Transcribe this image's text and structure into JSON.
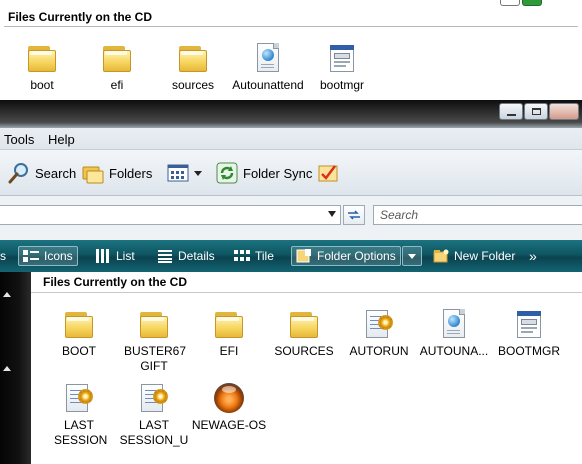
{
  "background_window": {
    "header": "Files Currently on the CD",
    "items": [
      {
        "name": "boot",
        "type": "folder"
      },
      {
        "name": "efi",
        "type": "folder"
      },
      {
        "name": "sources",
        "type": "folder"
      },
      {
        "name": "Autounattend",
        "type": "xml-document"
      },
      {
        "name": "bootmgr",
        "type": "executable"
      }
    ]
  },
  "menubar": {
    "tools": "Tools",
    "help": "Help"
  },
  "toolbar": {
    "search": "Search",
    "folders": "Folders",
    "folder_sync": "Folder Sync"
  },
  "addressbar": {
    "address_value": "",
    "search_placeholder": "Search"
  },
  "viewbar": {
    "edge_label": "s",
    "icons": "Icons",
    "list": "List",
    "details": "Details",
    "tile": "Tile",
    "folder_options": "Folder Options",
    "new_folder": "New Folder",
    "more": "»"
  },
  "content": {
    "header": "Files Currently on the CD",
    "items": [
      {
        "name": "BOOT",
        "type": "folder"
      },
      {
        "name": "BUSTER67 GIFT",
        "type": "folder"
      },
      {
        "name": "EFI",
        "type": "folder"
      },
      {
        "name": "SOURCES",
        "type": "folder"
      },
      {
        "name": "AUTORUN",
        "type": "setup-info"
      },
      {
        "name": "AUTOUNA...",
        "type": "xml-document"
      },
      {
        "name": "BOOTMGR",
        "type": "executable"
      },
      {
        "name": "LAST SESSION",
        "type": "setup-info"
      },
      {
        "name": "LAST SESSION_U",
        "type": "setup-info"
      },
      {
        "name": "NEWAGE-OS",
        "type": "disc-image"
      }
    ]
  }
}
